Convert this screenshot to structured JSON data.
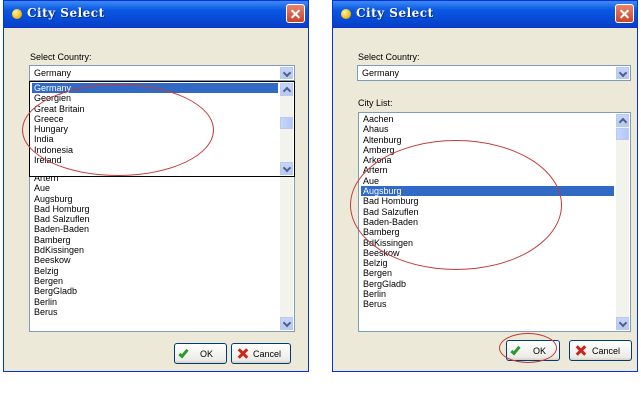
{
  "left_window": {
    "title": "City Select",
    "country_label": "Select Country:",
    "country_value": "Germany",
    "dropdown_options": [
      {
        "label": "Germany",
        "selected": true
      },
      {
        "label": "Georgien",
        "selected": false
      },
      {
        "label": "Great Britain",
        "selected": false
      },
      {
        "label": "Greece",
        "selected": false
      },
      {
        "label": "Hungary",
        "selected": false
      },
      {
        "label": "India",
        "selected": false
      },
      {
        "label": "Indonesia",
        "selected": false
      },
      {
        "label": "Ireland",
        "selected": false
      }
    ],
    "city_items": [
      "Artern",
      "Aue",
      "Augsburg",
      "Bad Homburg",
      "Bad Salzuflen",
      "Baden-Baden",
      "Bamberg",
      "BdKissingen",
      "Beeskow",
      "Belzig",
      "Bergen",
      "BergGladb",
      "Berlin",
      "Berus"
    ],
    "ok_label": "OK",
    "cancel_label": "Cancel"
  },
  "right_window": {
    "title": "City Select",
    "country_label": "Select Country:",
    "country_value": "Germany",
    "city_list_label": "City List:",
    "city_items": [
      {
        "label": "Aachen",
        "selected": false
      },
      {
        "label": "Ahaus",
        "selected": false
      },
      {
        "label": "Altenburg",
        "selected": false
      },
      {
        "label": "Amberg",
        "selected": false
      },
      {
        "label": "Arkona",
        "selected": false
      },
      {
        "label": "Artern",
        "selected": false
      },
      {
        "label": "Aue",
        "selected": false
      },
      {
        "label": "Augsburg",
        "selected": true
      },
      {
        "label": "Bad Homburg",
        "selected": false
      },
      {
        "label": "Bad Salzuflen",
        "selected": false
      },
      {
        "label": "Baden-Baden",
        "selected": false
      },
      {
        "label": "Bamberg",
        "selected": false
      },
      {
        "label": "BdKissingen",
        "selected": false
      },
      {
        "label": "Beeskow",
        "selected": false
      },
      {
        "label": "Belzig",
        "selected": false
      },
      {
        "label": "Bergen",
        "selected": false
      },
      {
        "label": "BergGladb",
        "selected": false
      },
      {
        "label": "Berlin",
        "selected": false
      },
      {
        "label": "Berus",
        "selected": false
      }
    ],
    "ok_label": "OK",
    "cancel_label": "Cancel"
  },
  "colors": {
    "titlebar": "#0a58e3",
    "selection": "#316ac5",
    "annotation": "#c43b3b",
    "ok_check": "#2c9a2c",
    "cancel_x": "#c8261f"
  },
  "icons": [
    "app-dot-icon",
    "close-icon",
    "chevron-down-icon",
    "chevron-up-icon",
    "check-icon",
    "cancel-x-icon"
  ]
}
